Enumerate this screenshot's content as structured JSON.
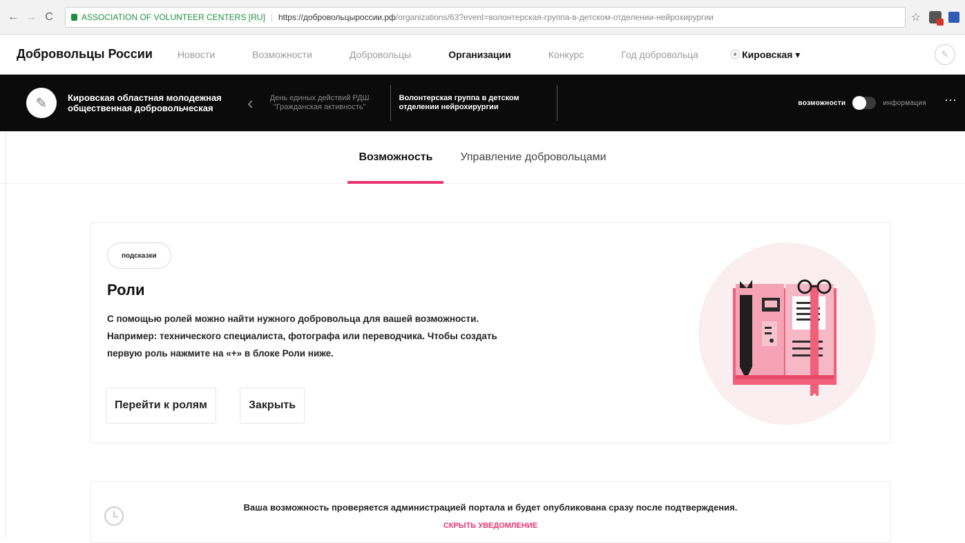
{
  "browser": {
    "back_icon": "←",
    "forward_icon": "→",
    "reload_icon": "C",
    "secure_label": "ASSOCIATION OF VOLUNTEER CENTERS [RU]",
    "url_host": "https://добровольцыроссии.рф",
    "url_path": "/organizations/63?event=волонтерская-группа-в-детском-отделении-нейрохирургии",
    "star_icon": "☆"
  },
  "site_nav": {
    "brand": "Добровольцы России",
    "items": [
      "Новости",
      "Возможности",
      "Добровольцы",
      "Организации",
      "Конкурс",
      "Год добровольца"
    ],
    "active_index": 3,
    "region": "Кировская ▾",
    "region_pin": "⦿",
    "avatar_icon": "✎"
  },
  "org_bar": {
    "org_name": "Кировская областная молодежная общественная добровольческая",
    "logo_icon": "✎",
    "prev_event": "День единых действий РДШ \"Гражданская активность\"",
    "back_chevron": "‹",
    "current_event": "Волонтерская группа в детском отделении нейрохирургии",
    "toggle_left": "возможности",
    "toggle_right": "информация",
    "more": "···"
  },
  "tabs": {
    "active": "Возможность",
    "other": "Управление добровольцами"
  },
  "hint": {
    "badge": "подсказки",
    "title": "Роли",
    "lines": [
      "С помощью ролей можно найти нужного добровольца для вашей возможности.",
      "Например: технического специалиста, фотографа или переводчика. Чтобы создать",
      "первую роль нажмите на «+» в блоке Роли ниже."
    ],
    "btn_roles": "Перейти к ролям",
    "btn_close": "Закрыть"
  },
  "notice": {
    "text": "Ваша возможность проверяется администрацией портала и будет опубликована сразу после подтверждения.",
    "link": "СКРЫТЬ УВЕДОМЛЕНИЕ"
  },
  "colors": {
    "accent": "#e8346e",
    "dark_bar": "#0b0b0b",
    "illus_bg": "#fbeef1"
  }
}
